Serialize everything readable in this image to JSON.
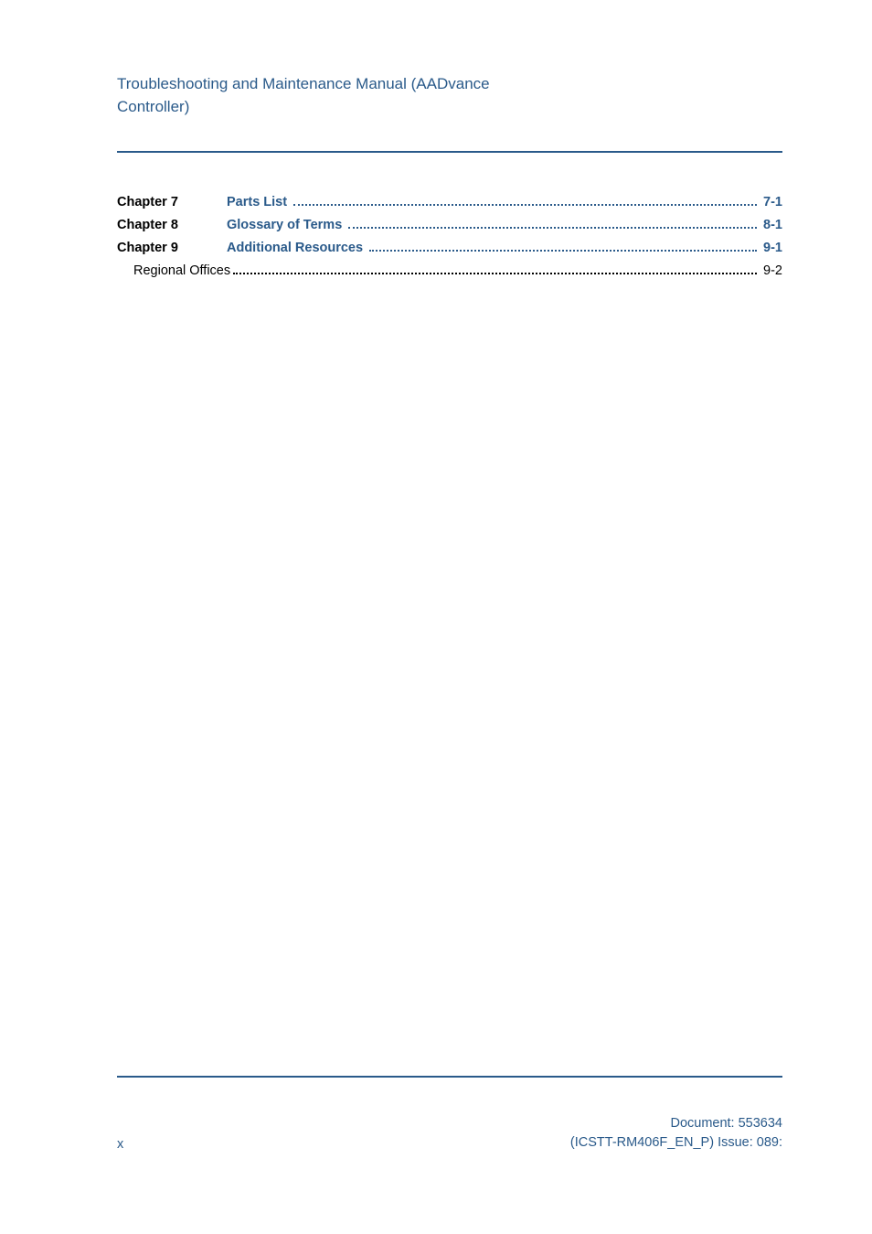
{
  "header": {
    "title_line1": "Troubleshooting and Maintenance Manual (AADvance",
    "title_line2": "Controller)"
  },
  "toc": {
    "entries": [
      {
        "chapter_label": "Chapter 7",
        "title": "Parts List",
        "page": "7-1"
      },
      {
        "chapter_label": "Chapter 8",
        "title": "Glossary of Terms",
        "page": "8-1"
      },
      {
        "chapter_label": "Chapter 9",
        "title": "Additional Resources",
        "page": "9-1"
      }
    ],
    "sub_entries": [
      {
        "title": "Regional Offices",
        "page": "9-2"
      }
    ]
  },
  "footer": {
    "page_number": "x",
    "doc_line1": "Document: 553634",
    "doc_line2": "(ICSTT-RM406F_EN_P) Issue: 089:"
  }
}
